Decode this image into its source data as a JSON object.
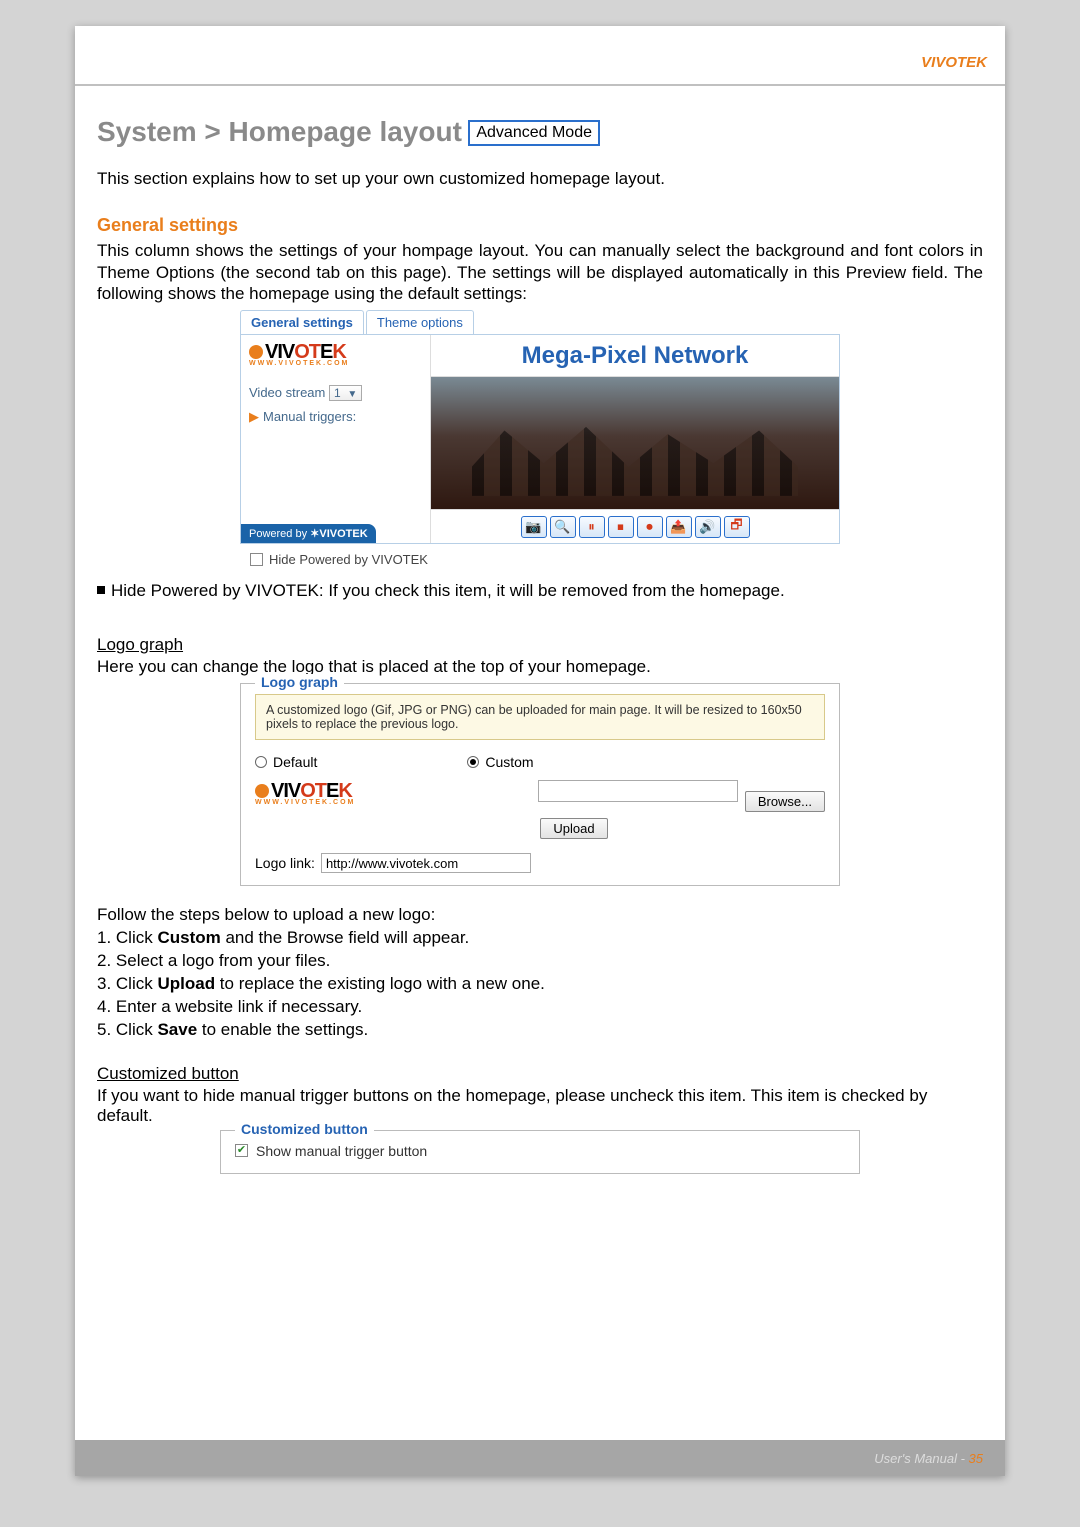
{
  "header": {
    "brand": "VIVOTEK"
  },
  "title": {
    "breadcrumb": "System > Homepage layout",
    "badge": "Advanced Mode"
  },
  "intro": "This section explains how to set up your own customized homepage layout.",
  "general": {
    "heading": "General settings",
    "desc": "This column shows the settings of your hompage layout. You can manually select the background and font colors in Theme Options (the second tab on this page). The settings will be displayed automatically in this Preview field. The following shows the homepage using the default settings:"
  },
  "preview": {
    "tabs": {
      "general": "General settings",
      "theme": "Theme options"
    },
    "logo_text": "VIVOTEK",
    "logo_sub": "WWW.VIVOTEK.COM",
    "main_title": "Mega-Pixel Network",
    "video_stream_label": "Video stream",
    "video_stream_value": "1",
    "manual_triggers": "Manual triggers:",
    "powered_by": "Powered by",
    "powered_brand": "VIVOTEK",
    "hide_label": "Hide Powered by VIVOTEK",
    "controls": [
      "📷",
      "🔍",
      "⏸",
      "⏹",
      "⏺",
      "📤",
      "🔊",
      "🗗"
    ]
  },
  "hide_desc": "Hide Powered by VIVOTEK: If you check this item, it will be removed from the homepage.",
  "logograph": {
    "heading_underline": "Logo graph",
    "subtext": "Here you can change the logo that is placed at the top of your homepage.",
    "legend": "Logo graph",
    "info": "A customized logo (Gif, JPG or PNG) can be uploaded for main page. It will be resized to 160x50 pixels to replace the previous logo.",
    "default_label": "Default",
    "custom_label": "Custom",
    "browse": "Browse...",
    "upload": "Upload",
    "link_label": "Logo link:",
    "link_value": "http://www.vivotek.com"
  },
  "steps": {
    "intro": "Follow the steps below to upload a new logo:",
    "s1a": "1. Click ",
    "s1b": "Custom",
    "s1c": " and the Browse field will appear.",
    "s2": "2. Select a logo from your files.",
    "s3a": "3. Click ",
    "s3b": "Upload",
    "s3c": " to replace the existing logo with a new one.",
    "s4": "4. Enter a website link if necessary.",
    "s5a": "5. Click ",
    "s5b": "Save",
    "s5c": " to enable the settings."
  },
  "custbtn": {
    "heading_underline": "Customized button",
    "desc": "If you want to hide manual trigger buttons on the homepage, please uncheck this item. This item is checked by default.",
    "legend": "Customized button",
    "checkbox_label": "Show manual trigger button"
  },
  "footer": {
    "text": "User's Manual - ",
    "page": "35"
  }
}
